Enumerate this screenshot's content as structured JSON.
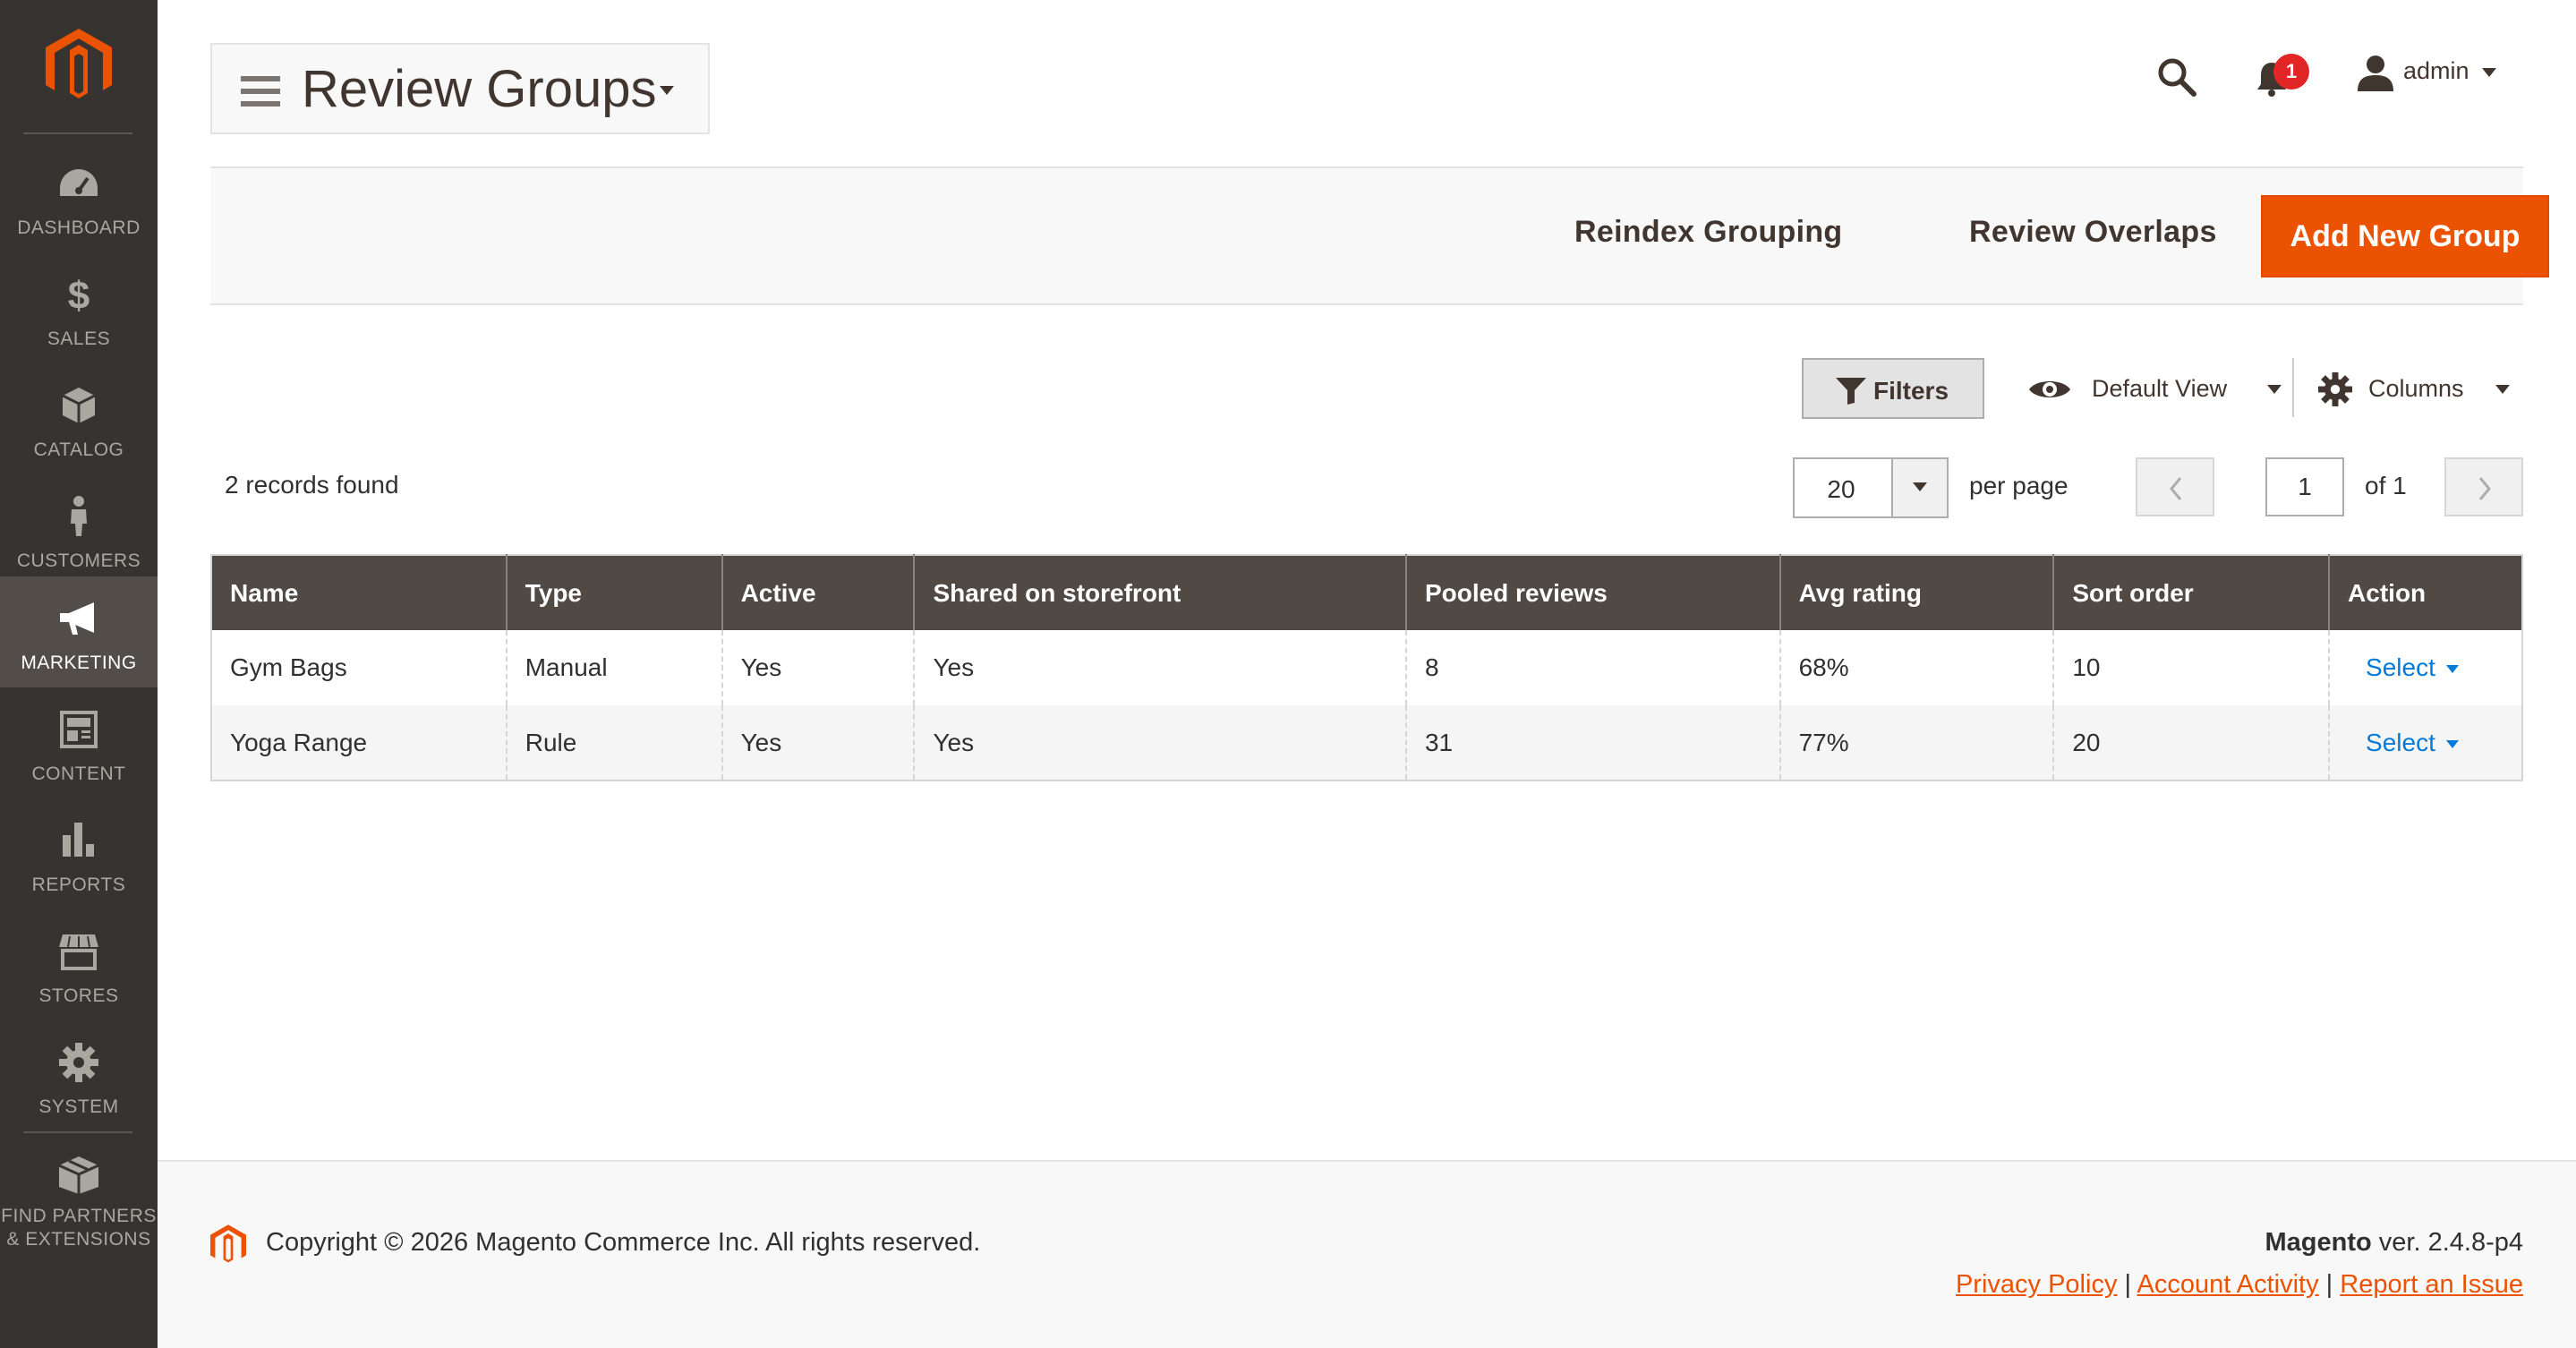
{
  "sidebar": {
    "items": [
      {
        "id": "dashboard",
        "label": "DASHBOARD"
      },
      {
        "id": "sales",
        "label": "SALES"
      },
      {
        "id": "catalog",
        "label": "CATALOG"
      },
      {
        "id": "customers",
        "label": "CUSTOMERS"
      },
      {
        "id": "marketing",
        "label": "MARKETING"
      },
      {
        "id": "content",
        "label": "CONTENT"
      },
      {
        "id": "reports",
        "label": "REPORTS"
      },
      {
        "id": "stores",
        "label": "STORES"
      },
      {
        "id": "system",
        "label": "SYSTEM"
      },
      {
        "id": "partners",
        "label_line1": "FIND PARTNERS",
        "label_line2": "& EXTENSIONS"
      }
    ],
    "active": "marketing"
  },
  "header": {
    "title": "Review Groups",
    "notifications_count": "1",
    "user": "admin"
  },
  "actions": {
    "reindex": "Reindex Grouping",
    "overlaps": "Review Overlaps",
    "add_new": "Add New Group"
  },
  "toolbar": {
    "filters": "Filters",
    "view": "Default View",
    "columns": "Columns"
  },
  "grid": {
    "records_found": "2 records found",
    "per_page_value": "20",
    "per_page_label": "per page",
    "page_current": "1",
    "page_of": "of 1",
    "columns": [
      "Name",
      "Type",
      "Active",
      "Shared on storefront",
      "Pooled reviews",
      "Avg rating",
      "Sort order",
      "Action"
    ],
    "rows": [
      {
        "name": "Gym Bags",
        "type": "Manual",
        "active": "Yes",
        "shared": "Yes",
        "pooled": "8",
        "avg": "68%",
        "sort": "10",
        "action": "Select"
      },
      {
        "name": "Yoga Range",
        "type": "Rule",
        "active": "Yes",
        "shared": "Yes",
        "pooled": "31",
        "avg": "77%",
        "sort": "20",
        "action": "Select"
      }
    ]
  },
  "footer": {
    "copyright": "Copyright © 2026 Magento Commerce Inc. All rights reserved.",
    "brand": "Magento",
    "version": " ver. 2.4.8-p4",
    "links": [
      "Privacy Policy",
      "Account Activity",
      "Report an Issue"
    ]
  },
  "colors": {
    "sidebar_bg": "#373330",
    "accent": "#eb5202",
    "grid_header": "#514943",
    "link": "#007bdb",
    "badge": "#e22626"
  }
}
